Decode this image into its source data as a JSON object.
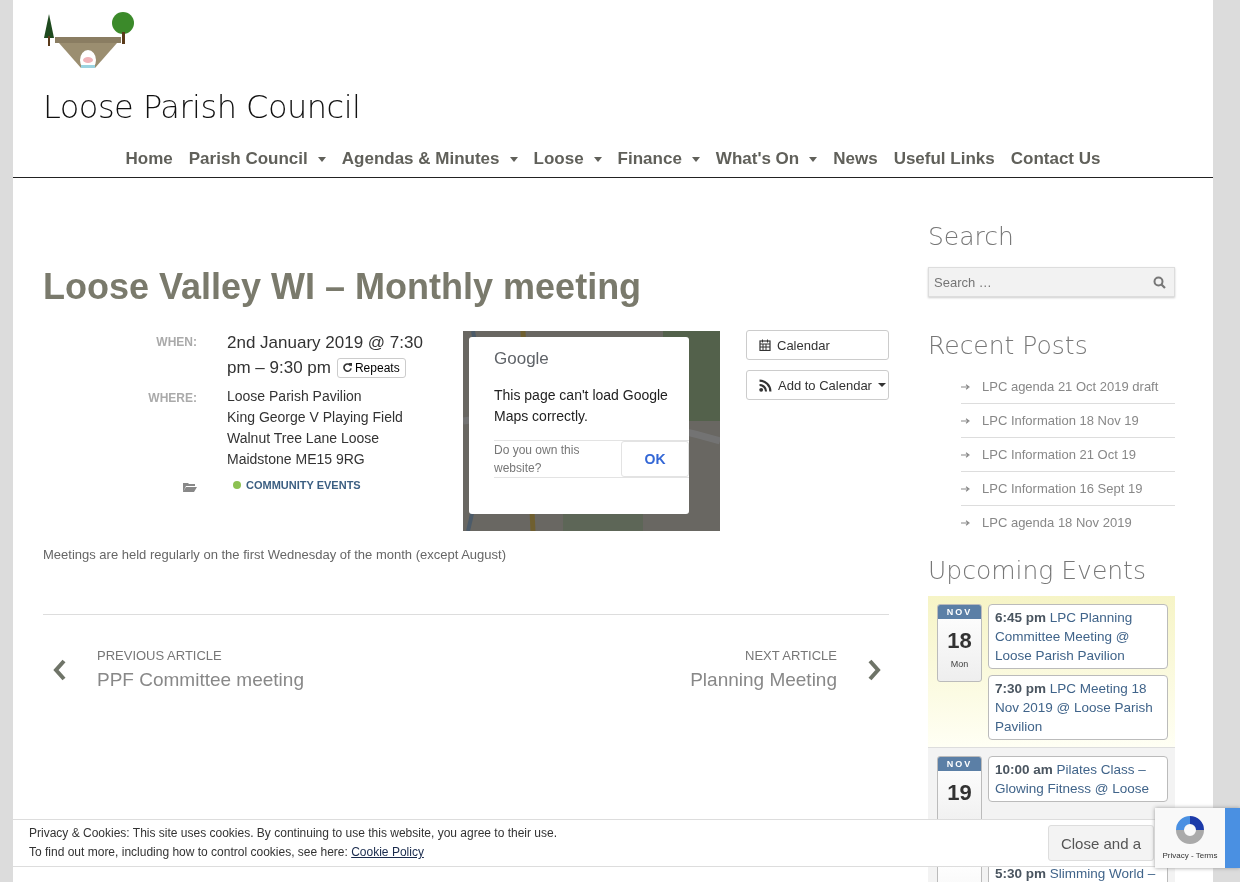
{
  "site": {
    "title": "Loose Parish Council"
  },
  "nav": [
    {
      "label": "Home",
      "dropdown": false
    },
    {
      "label": "Parish Council",
      "dropdown": true
    },
    {
      "label": "Agendas & Minutes",
      "dropdown": true
    },
    {
      "label": "Loose",
      "dropdown": true
    },
    {
      "label": "Finance",
      "dropdown": true
    },
    {
      "label": "What's On",
      "dropdown": true
    },
    {
      "label": "News",
      "dropdown": false
    },
    {
      "label": "Useful Links",
      "dropdown": false
    },
    {
      "label": "Contact Us",
      "dropdown": false
    }
  ],
  "event": {
    "title": "Loose Valley WI – Monthly meeting",
    "when_label": "WHEN:",
    "when_lines": [
      "2nd January 2019 @ 7:30",
      "pm – 9:30 pm"
    ],
    "repeats": "Repeats",
    "where_label": "WHERE:",
    "where": [
      "Loose Parish Pavilion",
      "King George V Playing Field",
      "Walnut Tree Lane Loose",
      "Maidstone ME15 9RG"
    ],
    "category": {
      "label": "COMMUNITY EVENTS",
      "color": "#8cc152"
    },
    "map_dialog": {
      "brand": "Google",
      "message": "This page can't load Google Maps correctly.",
      "question": "Do you own this website?",
      "button": "OK"
    },
    "buttons": [
      {
        "label": "Calendar",
        "kind": "calendar"
      },
      {
        "label": "Add to Calendar",
        "kind": "feed"
      }
    ],
    "description": "Meetings are held regularly on the first Wednesday of the month (except August)"
  },
  "post_nav": {
    "previous_label": "PREVIOUS ARTICLE",
    "previous": "PPF Committee meeting",
    "next_label": "NEXT ARTICLE",
    "next": "Planning Meeting"
  },
  "sidebar": {
    "search_heading": "Search",
    "search_placeholder": "Search …",
    "recent_heading": "Recent Posts",
    "recent_posts": [
      "LPC agenda 21 Oct 2019 draft",
      "LPC Information 18 Nov 19",
      "LPC Information 21 Oct 19",
      "LPC Information 16 Sept 19",
      "LPC agenda 18 Nov 2019"
    ],
    "events_heading": "Upcoming Events",
    "days": [
      {
        "month": "NOV",
        "day": "18",
        "weekday": "Mon",
        "today": true,
        "events": [
          {
            "time": "6:45 pm",
            "title": "LPC Planning Committee Meeting @ Loose Parish Pavilion"
          },
          {
            "time": "7:30 pm",
            "title": "LPC Meeting 18 Nov 2019 @ Loose Parish Pavilion"
          }
        ]
      },
      {
        "month": "NOV",
        "day": "19",
        "today": false,
        "events": [
          {
            "time": "10:00 am",
            "title": "Pilates Class – Glowing Fitness @ Loose"
          }
        ]
      },
      {
        "today": false,
        "events": [
          {
            "time": "5:30 pm",
            "title": "Slimming World –"
          }
        ]
      }
    ]
  },
  "cookie_bar": {
    "line1": "Privacy & Cookies: This site uses cookies. By continuing to use this website, you agree to their use.",
    "line2": "To find out more, including how to control cookies, see here:",
    "link": "Cookie Policy",
    "button": "Close and a"
  },
  "recaptcha": {
    "links": "Privacy - Terms"
  }
}
